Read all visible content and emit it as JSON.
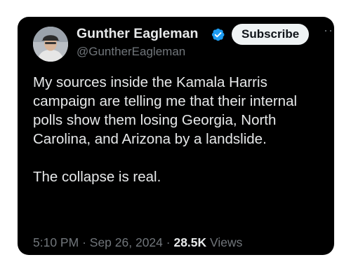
{
  "tweet": {
    "display_name": "Gunther Eagleman",
    "handle": "@GuntherEagleman",
    "subscribe_label": "Subscribe",
    "more_label": "···",
    "body_lines": [
      "My sources inside the Kamala Harris campaign are telling me that their internal polls show them losing Georgia, North Carolina, and Arizona by a landslide.",
      "The collapse is real."
    ],
    "time": "5:10 PM",
    "separator": "·",
    "date": "Sep 26, 2024",
    "views_count": "28.5K",
    "views_label": "Views"
  },
  "icons": {
    "verified": "verified-badge-icon",
    "avatar": "profile-avatar"
  },
  "colors": {
    "card_background": "#000000",
    "primary_text": "#e7e9ea",
    "secondary_text": "#71767b",
    "verified_blue": "#1d9bf0",
    "subscribe_bg": "#eff3f4"
  }
}
